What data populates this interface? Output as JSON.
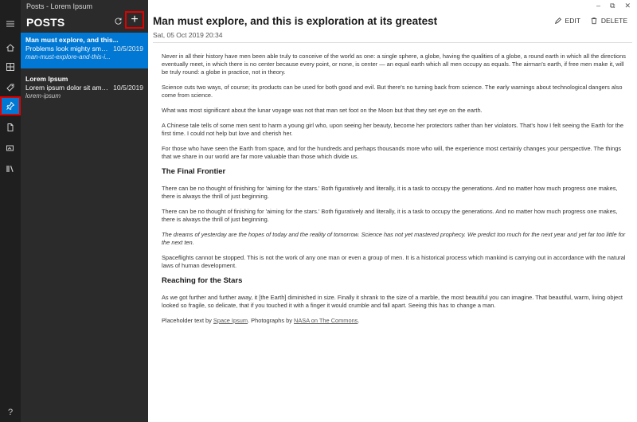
{
  "app": {
    "title": "Posts - Lorem Ipsum"
  },
  "window": {
    "minimize_icon": "minimize-icon",
    "restore_icon": "restore-icon",
    "close_icon": "close-icon"
  },
  "rail": {
    "items": [
      {
        "icon": "menu-icon"
      },
      {
        "icon": "home-icon"
      },
      {
        "icon": "grid-icon"
      },
      {
        "icon": "tag-icon"
      },
      {
        "icon": "pin-icon",
        "active": true
      },
      {
        "icon": "page-icon"
      },
      {
        "icon": "media-icon"
      },
      {
        "icon": "library-icon"
      }
    ],
    "help_label": "?"
  },
  "panel": {
    "header": "POSTS",
    "refresh_icon": "refresh-icon",
    "add_label": "+",
    "posts": [
      {
        "title": "Man must explore, and this...",
        "excerpt": "Problems look mighty small f...",
        "date": "10/5/2019",
        "slug": "man-must-explore-and-this-i...",
        "selected": true
      },
      {
        "title": "Lorem Ipsum",
        "excerpt": "Lorem ipsum dolor sit amet,...",
        "date": "10/5/2019",
        "slug": "lorem-ipsum",
        "selected": false
      }
    ]
  },
  "article": {
    "title": "Man must explore, and this is exploration at its greatest",
    "date": "Sat, 05 Oct 2019 20:34",
    "edit_label": "EDIT",
    "delete_label": "DELETE",
    "paragraphs": [
      "Never in all their history have men been able truly to conceive of the world as one: a single sphere, a globe, having the qualities of a globe, a round earth in which all the directions eventually meet, in which there is no center because every point, or none, is center — an equal earth which all men occupy as equals. The airman's earth, if free men make it, will be truly round: a globe in practice, not in theory.",
      "Science cuts two ways, of course; its products can be used for both good and evil. But there's no turning back from science. The early warnings about technological dangers also come from science.",
      "What was most significant about the lunar voyage was not that man set foot on the Moon but that they set eye on the earth.",
      "A Chinese tale tells of some men sent to harm a young girl who, upon seeing her beauty, become her protectors rather than her violators. That's how I felt seeing the Earth for the first time. I could not help but love and cherish her.",
      "For those who have seen the Earth from space, and for the hundreds and perhaps thousands more who will, the experience most certainly changes your perspective. The things that we share in our world are far more valuable than those which divide us."
    ],
    "heading1": "The Final Frontier",
    "paragraphs2": [
      "There can be no thought of finishing for 'aiming for the stars.' Both figuratively and literally, it is a task to occupy the generations. And no matter how much progress one makes, there is always the thrill of just beginning.",
      "There can be no thought of finishing for 'aiming for the stars.' Both figuratively and literally, it is a task to occupy the generations. And no matter how much progress one makes, there is always the thrill of just beginning."
    ],
    "quote": "The dreams of yesterday are the hopes of today and the reality of tomorrow. Science has not yet mastered prophecy. We predict too much for the next year and yet far too little for the next ten.",
    "paragraph3": "Spaceflights cannot be stopped. This is not the work of any one man or even a group of men. It is a historical process which mankind is carrying out in accordance with the natural laws of human development.",
    "heading2": "Reaching for the Stars",
    "paragraph4": "As we got further and further away, it [the Earth] diminished in size. Finally it shrank to the size of a marble, the most beautiful you can imagine. That beautiful, warm, living object looked so fragile, so delicate, that if you touched it with a finger it would crumble and fall apart. Seeing this has to change a man.",
    "credit": {
      "prefix": "Placeholder text by ",
      "link1": "Space Ipsum",
      "middle": ". Photographs by ",
      "link2": "NASA on The Commons",
      "suffix": "."
    }
  },
  "colors": {
    "rail_bg": "#1f1f1f",
    "panel_bg": "#2b2b2b",
    "accent": "#0078d4",
    "highlight": "#e00000"
  }
}
